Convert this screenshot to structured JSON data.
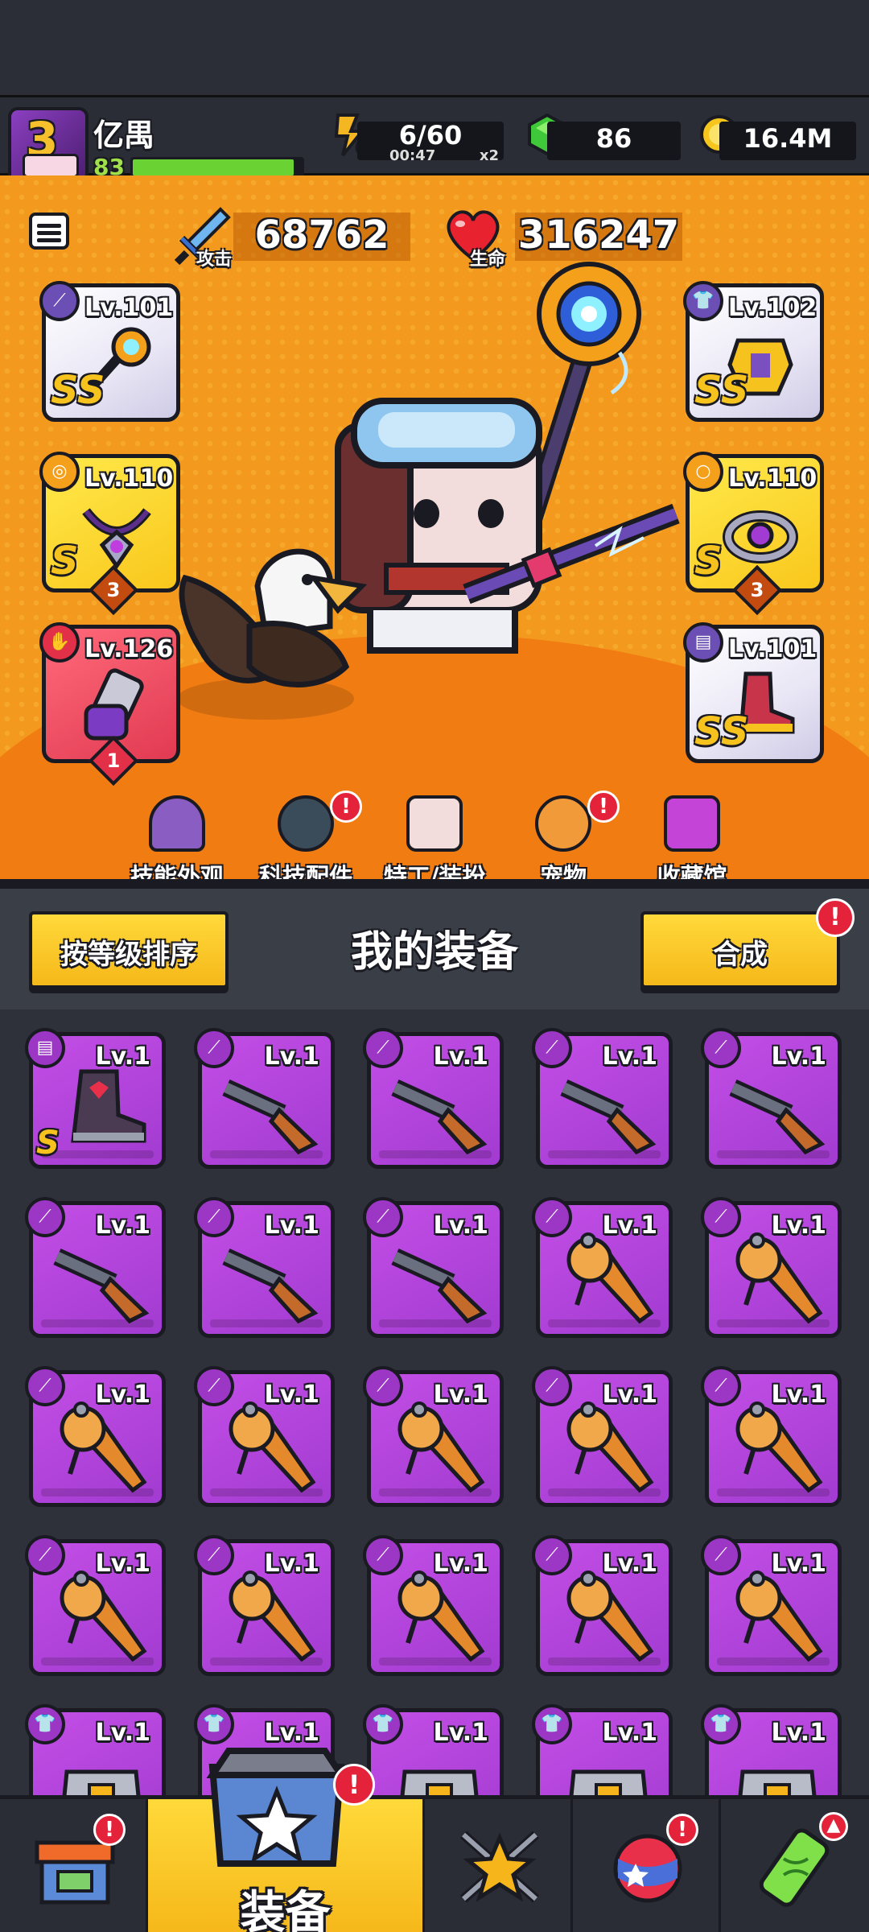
{
  "player": {
    "name": "亿禺",
    "level": "83",
    "avatar_level": "3",
    "xp_fraction": 0.95
  },
  "resources": {
    "energy": "6/60",
    "energy_timer": "00:47",
    "energy_multiplier": "x2",
    "gems": "86",
    "coins": "16.4M"
  },
  "stats": {
    "attack_label": "攻击",
    "attack_value": "68762",
    "hp_label": "生命",
    "hp_value": "316247"
  },
  "equipped": {
    "left": [
      {
        "level": "Lv.101",
        "grade": "SS",
        "slot_icon": "weapon-icon",
        "color": "white"
      },
      {
        "level": "Lv.110",
        "grade": "S",
        "stars": "3",
        "slot_icon": "necklace-icon",
        "color": "yellow"
      },
      {
        "level": "Lv.126",
        "grade": "",
        "stars": "1",
        "slot_icon": "glove-icon",
        "color": "red"
      }
    ],
    "right": [
      {
        "level": "Lv.102",
        "grade": "SS",
        "slot_icon": "armor-icon",
        "color": "white"
      },
      {
        "level": "Lv.110",
        "grade": "S",
        "stars": "3",
        "slot_icon": "ring-icon",
        "color": "yellow"
      },
      {
        "level": "Lv.101",
        "grade": "SS",
        "slot_icon": "boots-icon",
        "color": "white"
      }
    ]
  },
  "quicknav": [
    {
      "label": "技能外观",
      "badge": false
    },
    {
      "label": "科技配件",
      "badge": true
    },
    {
      "label": "特工/装扮",
      "badge": false
    },
    {
      "label": "宠物",
      "badge": true
    },
    {
      "label": "收藏馆",
      "badge": false
    }
  ],
  "equipment_panel": {
    "sort_button": "按等级排序",
    "title": "我的装备",
    "combine_button": "合成",
    "combine_badge": "!"
  },
  "inventory": [
    {
      "level": "Lv.1",
      "item": "boots",
      "grade": "S"
    },
    {
      "level": "Lv.1",
      "item": "shotgun"
    },
    {
      "level": "Lv.1",
      "item": "shotgun"
    },
    {
      "level": "Lv.1",
      "item": "shotgun"
    },
    {
      "level": "Lv.1",
      "item": "shotgun"
    },
    {
      "level": "Lv.1",
      "item": "shotgun"
    },
    {
      "level": "Lv.1",
      "item": "shotgun"
    },
    {
      "level": "Lv.1",
      "item": "shotgun"
    },
    {
      "level": "Lv.1",
      "item": "drill"
    },
    {
      "level": "Lv.1",
      "item": "drill"
    },
    {
      "level": "Lv.1",
      "item": "drill"
    },
    {
      "level": "Lv.1",
      "item": "drill"
    },
    {
      "level": "Lv.1",
      "item": "drill"
    },
    {
      "level": "Lv.1",
      "item": "drill"
    },
    {
      "level": "Lv.1",
      "item": "drill"
    },
    {
      "level": "Lv.1",
      "item": "drill"
    },
    {
      "level": "Lv.1",
      "item": "drill"
    },
    {
      "level": "Lv.1",
      "item": "drill"
    },
    {
      "level": "Lv.1",
      "item": "drill"
    },
    {
      "level": "Lv.1",
      "item": "drill"
    },
    {
      "level": "Lv.1",
      "item": "armor"
    },
    {
      "level": "Lv.1",
      "item": "armor"
    },
    {
      "level": "Lv.1",
      "item": "armor"
    },
    {
      "level": "Lv.1",
      "item": "armor"
    },
    {
      "level": "Lv.1",
      "item": "armor"
    }
  ],
  "bottom_nav": {
    "shop_badge": "!",
    "equip_label": "装备",
    "equip_badge": "!",
    "planet_badge": "!"
  },
  "colors": {
    "accent_yellow": "#f6b81a",
    "hero_orange": "#f39a1e",
    "epic_purple": "#b044dc",
    "badge_red": "#e4233a"
  }
}
